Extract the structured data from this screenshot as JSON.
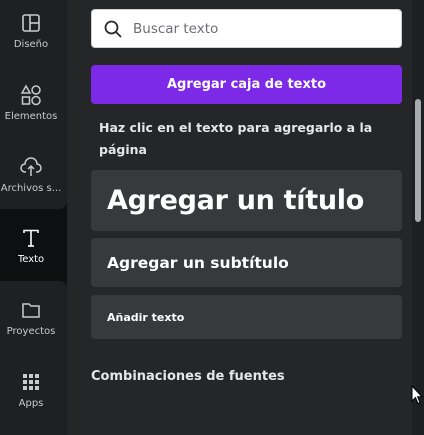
{
  "sidebar": {
    "items": [
      {
        "label": "Diseño",
        "icon": "layout-icon"
      },
      {
        "label": "Elementos",
        "icon": "shapes-icon"
      },
      {
        "label": "Archivos s...",
        "icon": "cloud-upload-icon"
      },
      {
        "label": "Texto",
        "icon": "text-t-icon",
        "active": true
      },
      {
        "label": "Proyectos",
        "icon": "folder-icon"
      },
      {
        "label": "Apps",
        "icon": "apps-grid-icon"
      }
    ]
  },
  "panel": {
    "search": {
      "placeholder": "Buscar texto",
      "value": ""
    },
    "add_textbox_button": "Agregar caja de texto",
    "hint": "Haz clic en el texto para agregarlo a la página",
    "text_options": {
      "title": "Agregar un título",
      "subtitle": "Agregar un subtítulo",
      "body": "Añadir texto"
    },
    "font_combinations_heading": "Combinaciones de fuentes"
  },
  "colors": {
    "accent": "#7d2ae8",
    "panel_bg": "#252627",
    "sidebar_bg": "#1f2023",
    "card_bg": "#38393b"
  }
}
